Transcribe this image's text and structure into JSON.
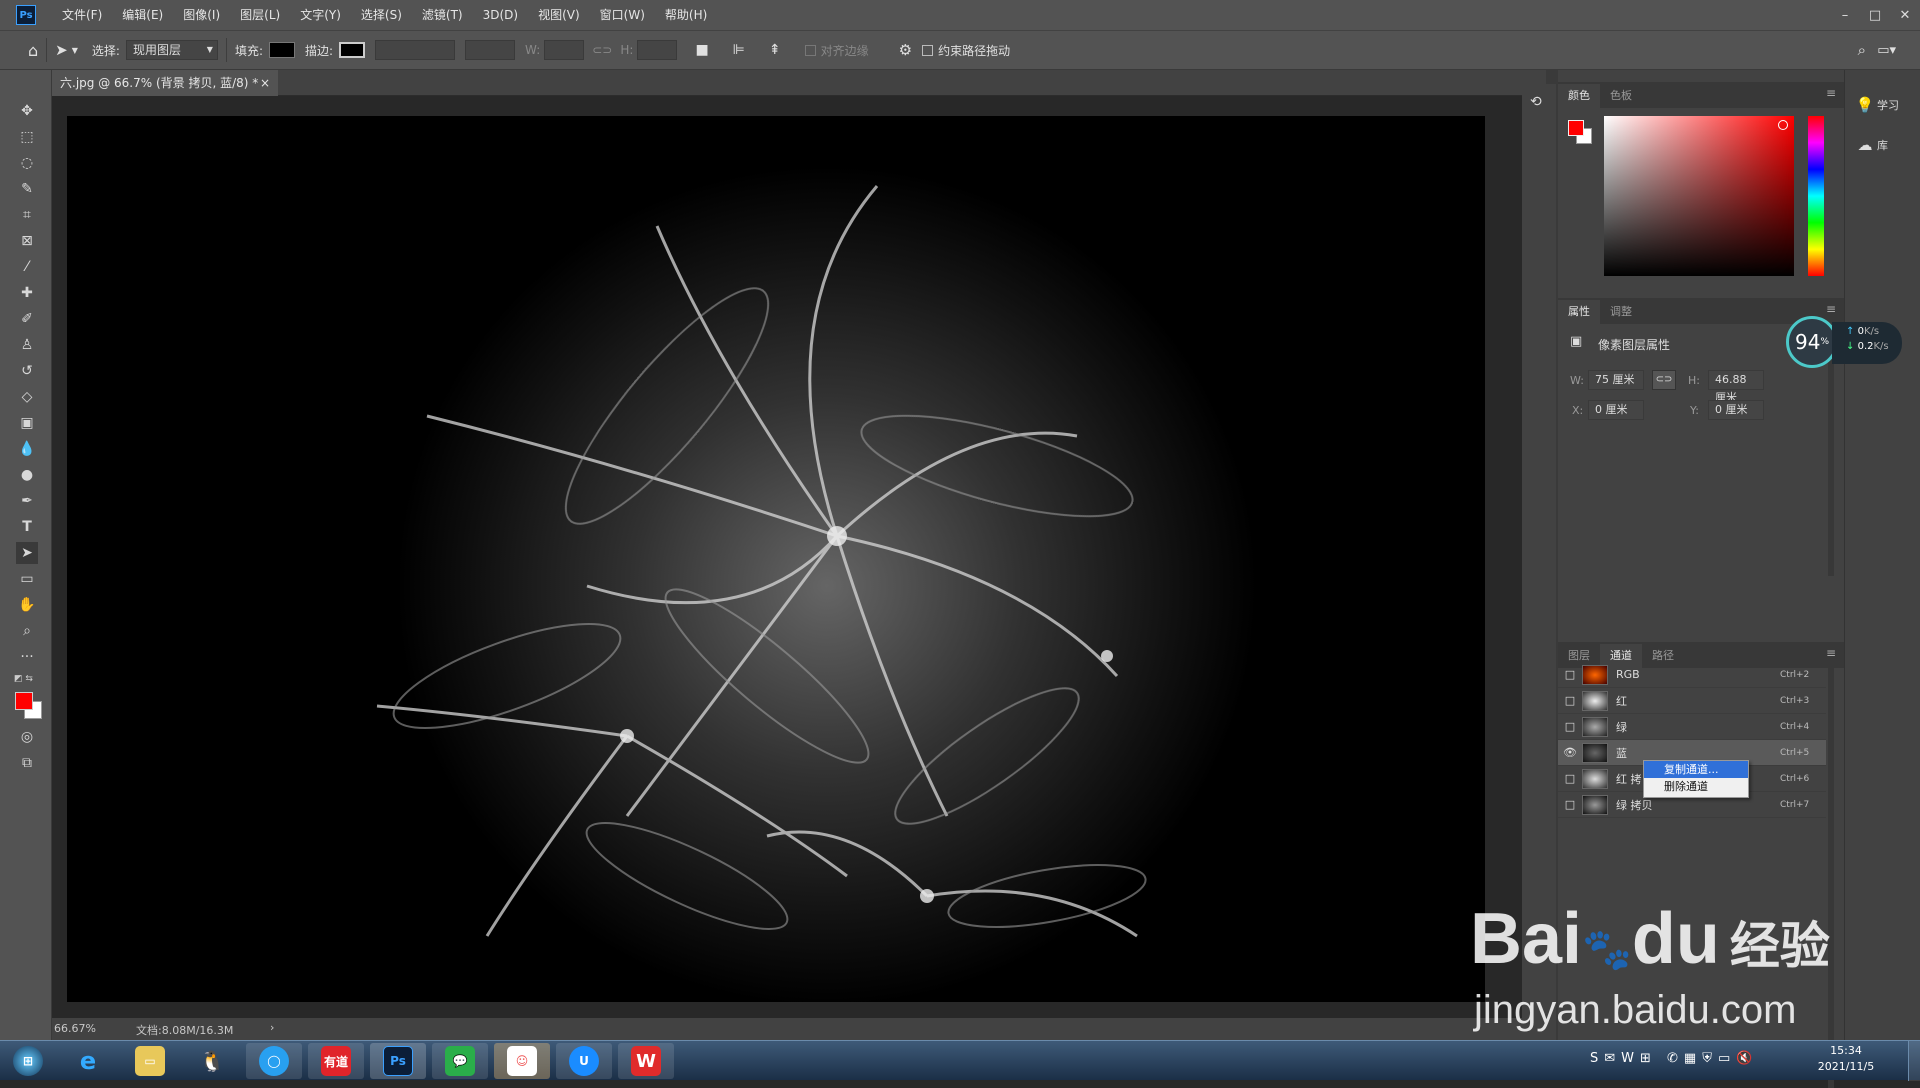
{
  "app": {
    "logo": "Ps"
  },
  "menu": [
    "文件(F)",
    "编辑(E)",
    "图像(I)",
    "图层(L)",
    "文字(Y)",
    "选择(S)",
    "滤镜(T)",
    "3D(D)",
    "视图(V)",
    "窗口(W)",
    "帮助(H)"
  ],
  "options": {
    "select_label": "选择:",
    "select_value": "现用图层",
    "fill_label": "填充:",
    "stroke_label": "描边:",
    "w_label": "W:",
    "h_label": "H:",
    "align_edges": "对齐边缘",
    "constrain_path": "约束路径拖动"
  },
  "document": {
    "tab_title": "六.jpg @ 66.7% (背景 拷贝, 蓝/8) *",
    "close": "×"
  },
  "status": {
    "zoom": "66.67%",
    "doc_size": "文档:8.08M/16.3M",
    "arrow": "›"
  },
  "color_panel": {
    "tabs": [
      "颜色",
      "色板"
    ],
    "fg_color": "#ff0000"
  },
  "properties_panel": {
    "tabs": [
      "属性",
      "调整"
    ],
    "title": "像素图层属性",
    "w_label": "W:",
    "w_value": "75 厘米",
    "h_label": "H:",
    "h_value": "46.88 厘米",
    "x_label": "X:",
    "x_value": "0 厘米",
    "y_label": "Y:",
    "y_value": "0 厘米"
  },
  "layers_panel": {
    "tabs": [
      "图层",
      "通道",
      "路径"
    ],
    "channels": [
      {
        "name": "RGB",
        "shortcut": "Ctrl+2",
        "visible": false
      },
      {
        "name": "红",
        "shortcut": "Ctrl+3",
        "visible": false
      },
      {
        "name": "绿",
        "shortcut": "Ctrl+4",
        "visible": false
      },
      {
        "name": "蓝",
        "shortcut": "Ctrl+5",
        "visible": true
      },
      {
        "name": "红 拷",
        "shortcut": "Ctrl+6",
        "visible": false
      },
      {
        "name": "绿 拷贝",
        "shortcut": "Ctrl+7",
        "visible": false
      }
    ]
  },
  "context_menu": {
    "items": [
      "复制通道...",
      "删除通道"
    ]
  },
  "learn": {
    "learn": "学习",
    "library": "库"
  },
  "net_widget": {
    "percent": "94",
    "pct_sign": "%",
    "up": "0",
    "down": "0.2",
    "unit": "K/s"
  },
  "taskbar": {
    "time": "15:34",
    "date": "2021/11/5",
    "youdao": "有道"
  },
  "watermark": {
    "brand": "Bai",
    "brand2": "du",
    "cn": "经验",
    "url": "jingyan.baidu.com"
  }
}
